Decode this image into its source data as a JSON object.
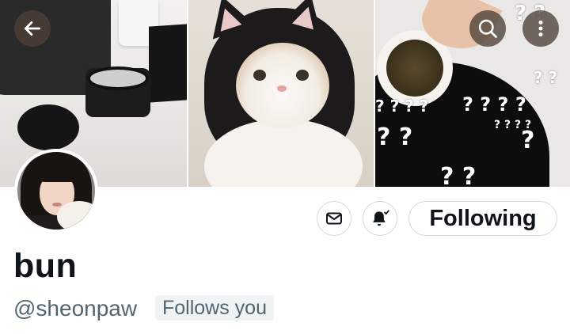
{
  "profile": {
    "display_name": "bun",
    "handle": "@sheonpaw",
    "follows_you_label": "Follows you"
  },
  "actions": {
    "follow_label": "Following"
  },
  "header_buttons": {
    "back_icon": "arrow-left-icon",
    "search_icon": "search-icon",
    "more_icon": "more-vertical-icon"
  },
  "banner": {
    "question_marks": [
      "? ?",
      "? ? ? ?",
      "? ? ? ?",
      "? ? ? ?",
      "? ?",
      "? ?",
      "?",
      "? ?"
    ]
  },
  "colors": {
    "overlay_button": "#4d4037",
    "text_primary": "#0f1419",
    "text_secondary": "#536471",
    "border": "#cfd9de",
    "badge_bg": "#eff3f4"
  }
}
